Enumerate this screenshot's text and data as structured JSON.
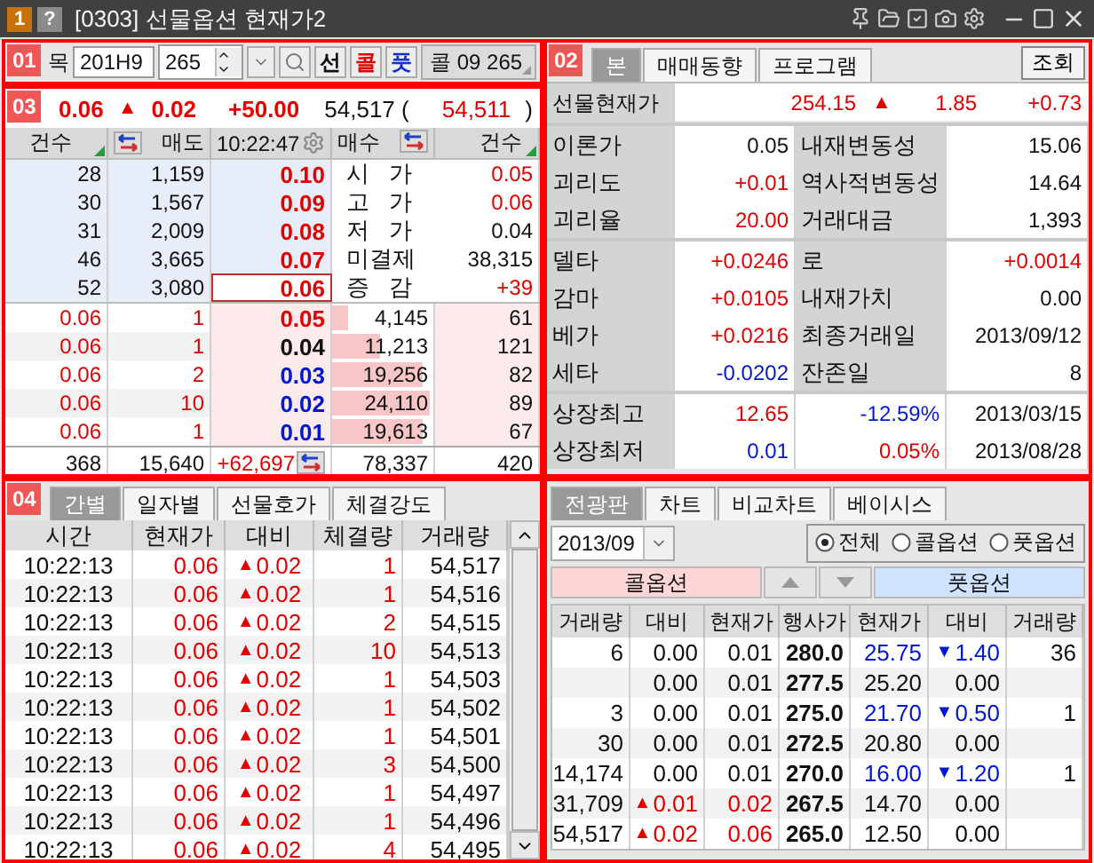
{
  "window": {
    "title": "[0303] 선물옵션 현재가2",
    "badges": [
      {
        "text": "1",
        "kind": "number"
      },
      {
        "text": "?",
        "kind": "help"
      }
    ]
  },
  "toolbar": {
    "marker": "01",
    "code_label": "목",
    "code": "201H9",
    "strike": "265",
    "type_buttons": [
      {
        "label": "선",
        "kind": "futures"
      },
      {
        "label": "콜",
        "kind": "call"
      },
      {
        "label": "풋",
        "kind": "put"
      }
    ],
    "selection": "콜 09 265"
  },
  "quote": {
    "marker": "03",
    "price": {
      "text": "0.06",
      "color": "#e00000"
    },
    "change": {
      "text": "0.02",
      "color": "#e00000",
      "arrow": "▲"
    },
    "rate": {
      "text": "+50.00",
      "color": "#e00000"
    },
    "volume": "54,517 (",
    "prev_volume": {
      "text": "54,511",
      "color": "#e00000"
    },
    "close": ")"
  },
  "orderbook": {
    "columns": [
      "건수",
      "매도",
      "10:22:47",
      "매수",
      "건수"
    ],
    "asks": [
      {
        "count": "28",
        "qty": "1,159",
        "price": {
          "text": "0.10",
          "color": "#e00000"
        },
        "current": false,
        "label": "시   가",
        "value": {
          "text": "0.05",
          "color": "#e00000"
        }
      },
      {
        "count": "30",
        "qty": "1,567",
        "price": {
          "text": "0.09",
          "color": "#e00000"
        },
        "current": false,
        "label": "고   가",
        "value": {
          "text": "0.06",
          "color": "#e00000"
        }
      },
      {
        "count": "31",
        "qty": "2,009",
        "price": {
          "text": "0.08",
          "color": "#e00000"
        },
        "current": false,
        "label": "저   가",
        "value": {
          "text": "0.04",
          "color": "#111111"
        }
      },
      {
        "count": "46",
        "qty": "3,665",
        "price": {
          "text": "0.07",
          "color": "#e00000"
        },
        "current": false,
        "label": "미결제",
        "value": {
          "text": "38,315",
          "color": "#111111"
        }
      },
      {
        "count": "52",
        "qty": "3,080",
        "price": {
          "text": "0.06",
          "color": "#e00000"
        },
        "current": true,
        "label": "증   감",
        "value": {
          "text": "+39",
          "color": "#e00000"
        }
      }
    ],
    "bids": [
      {
        "col_1": {
          "text": "0.06",
          "color": "#e00000"
        },
        "col_2": {
          "text": "1",
          "color": "#e00000"
        },
        "price": {
          "text": "0.05",
          "color": "#e00000"
        },
        "qty": "4,145",
        "level": 0.16,
        "count": "61"
      },
      {
        "col_1": {
          "text": "0.06",
          "color": "#e00000"
        },
        "col_2": {
          "text": "1",
          "color": "#e00000"
        },
        "price": {
          "text": "0.04",
          "color": "#111111"
        },
        "qty": "11,213",
        "level": 0.48,
        "count": "121"
      },
      {
        "col_1": {
          "text": "0.06",
          "color": "#e00000"
        },
        "col_2": {
          "text": "2",
          "color": "#e00000"
        },
        "price": {
          "text": "0.03",
          "color": "#0018d0"
        },
        "qty": "19,256",
        "level": 0.9,
        "count": "82"
      },
      {
        "col_1": {
          "text": "0.06",
          "color": "#e00000"
        },
        "col_2": {
          "text": "10",
          "color": "#e00000"
        },
        "price": {
          "text": "0.02",
          "color": "#0018d0"
        },
        "qty": "24,110",
        "level": 0.97,
        "count": "89"
      },
      {
        "col_1": {
          "text": "0.06",
          "color": "#e00000"
        },
        "col_2": {
          "text": "1",
          "color": "#e00000"
        },
        "price": {
          "text": "0.01",
          "color": "#0018d0"
        },
        "qty": "19,613",
        "level": 0.9,
        "count": "67"
      }
    ],
    "totals": {
      "ask_count": "368",
      "ask_qty": "15,640",
      "diff": {
        "text": "+62,697",
        "color": "#e00000"
      },
      "bid_qty": "78,337",
      "bid_count": "420"
    }
  },
  "info": {
    "marker": "02",
    "tabs": [
      {
        "label": "본",
        "selected": true
      },
      {
        "label": "매매동향",
        "selected": false
      },
      {
        "label": "프로그램",
        "selected": false
      }
    ],
    "query_button": "조회",
    "current": {
      "label": "선물현재가",
      "price": {
        "text": "254.15",
        "color": "#e00000"
      },
      "change": {
        "text": "1.85",
        "color": "#e00000",
        "arrow": "▲"
      },
      "rate": {
        "text": "+0.73",
        "color": "#e00000"
      }
    },
    "groups": [
      [
        {
          "label": "이론가",
          "value": {
            "text": "0.05",
            "color": "#111111"
          },
          "label_2": "내재변동성",
          "value_2": {
            "text": "15.06",
            "color": "#111111"
          }
        },
        {
          "label": "괴리도",
          "value": {
            "text": "+0.01",
            "color": "#e00000"
          },
          "label_2": "역사적변동성",
          "value_2": {
            "text": "14.64",
            "color": "#111111"
          }
        },
        {
          "label": "괴리율",
          "value": {
            "text": "20.00",
            "color": "#e00000"
          },
          "label_2": "거래대금",
          "value_2": {
            "text": "1,393",
            "color": "#111111"
          }
        }
      ],
      [
        {
          "label": "델타",
          "value": {
            "text": "+0.0246",
            "color": "#e00000"
          },
          "label_2": "로",
          "value_2": {
            "text": "+0.0014",
            "color": "#e00000"
          }
        },
        {
          "label": "감마",
          "value": {
            "text": "+0.0105",
            "color": "#e00000"
          },
          "label_2": "내재가치",
          "value_2": {
            "text": "0.00",
            "color": "#111111"
          }
        },
        {
          "label": "베가",
          "value": {
            "text": "+0.0216",
            "color": "#e00000"
          },
          "label_2": "최종거래일",
          "value_2": {
            "text": "2013/09/12",
            "color": "#111111"
          }
        },
        {
          "label": "세타",
          "value": {
            "text": "-0.0202",
            "color": "#0018d0"
          },
          "label_2": "잔존일",
          "value_2": {
            "text": "8",
            "color": "#111111"
          }
        }
      ]
    ],
    "listing": [
      {
        "label": "상장최고",
        "value": {
          "text": "12.65",
          "color": "#e00000"
        },
        "rate": {
          "text": "-12.59%",
          "color": "#0018d0"
        },
        "date": "2013/03/15"
      },
      {
        "label": "상장최저",
        "value": {
          "text": "0.01",
          "color": "#0018d0"
        },
        "rate": {
          "text": "0.05%",
          "color": "#e00000"
        },
        "date": "2013/08/28"
      }
    ]
  },
  "trades": {
    "marker": "04",
    "tabs": [
      {
        "label": "간별",
        "selected": true
      },
      {
        "label": "일자별",
        "selected": false
      },
      {
        "label": "선물호가",
        "selected": false
      },
      {
        "label": "체결강도",
        "selected": false
      }
    ],
    "columns": [
      "시간",
      "현재가",
      "대비",
      "체결량",
      "거래량"
    ],
    "rows": [
      {
        "time": "10:22:13",
        "price": "0.06",
        "arrow": "▲",
        "change": "0.02",
        "qty": "1",
        "volume": "54,517",
        "color": "#e00000"
      },
      {
        "time": "10:22:13",
        "price": "0.06",
        "arrow": "▲",
        "change": "0.02",
        "qty": "1",
        "volume": "54,516",
        "color": "#e00000"
      },
      {
        "time": "10:22:13",
        "price": "0.06",
        "arrow": "▲",
        "change": "0.02",
        "qty": "2",
        "volume": "54,515",
        "color": "#e00000"
      },
      {
        "time": "10:22:13",
        "price": "0.06",
        "arrow": "▲",
        "change": "0.02",
        "qty": "10",
        "volume": "54,513",
        "color": "#e00000"
      },
      {
        "time": "10:22:13",
        "price": "0.06",
        "arrow": "▲",
        "change": "0.02",
        "qty": "1",
        "volume": "54,503",
        "color": "#e00000"
      },
      {
        "time": "10:22:13",
        "price": "0.06",
        "arrow": "▲",
        "change": "0.02",
        "qty": "1",
        "volume": "54,502",
        "color": "#e00000"
      },
      {
        "time": "10:22:13",
        "price": "0.06",
        "arrow": "▲",
        "change": "0.02",
        "qty": "1",
        "volume": "54,501",
        "color": "#e00000"
      },
      {
        "time": "10:22:13",
        "price": "0.06",
        "arrow": "▲",
        "change": "0.02",
        "qty": "3",
        "volume": "54,500",
        "color": "#e00000"
      },
      {
        "time": "10:22:13",
        "price": "0.06",
        "arrow": "▲",
        "change": "0.02",
        "qty": "1",
        "volume": "54,497",
        "color": "#e00000"
      },
      {
        "time": "10:22:13",
        "price": "0.06",
        "arrow": "▲",
        "change": "0.02",
        "qty": "1",
        "volume": "54,496",
        "color": "#e00000"
      },
      {
        "time": "10:22:13",
        "price": "0.06",
        "arrow": "▲",
        "change": "0.02",
        "qty": "4",
        "volume": "54,495",
        "color": "#e00000"
      }
    ]
  },
  "board": {
    "tabs": [
      {
        "label": "전광판",
        "selected": true
      },
      {
        "label": "차트",
        "selected": false
      },
      {
        "label": "비교차트",
        "selected": false
      },
      {
        "label": "베이시스",
        "selected": false
      }
    ],
    "month": "2013/09",
    "filters": [
      {
        "label": "전체",
        "selected": true
      },
      {
        "label": "콜옵션",
        "selected": false
      },
      {
        "label": "풋옵션",
        "selected": false
      }
    ],
    "call_header": "콜옵션",
    "put_header": "풋옵션",
    "columns": [
      "거래량",
      "대비",
      "현재가",
      "행사가",
      "현재가",
      "대비",
      "거래량"
    ],
    "rows": [
      [
        {
          "text": "6",
          "color": "#111111"
        },
        {
          "text": "0.00",
          "color": "#111111"
        },
        {
          "text": "0.01",
          "color": "#111111"
        },
        {
          "text": "280.0",
          "color": "#111111"
        },
        {
          "text": "25.75",
          "color": "#0018d0"
        },
        {
          "text": "1.40",
          "color": "#0018d0",
          "arrow": "▼"
        },
        {
          "text": "36",
          "color": "#111111"
        }
      ],
      [
        null,
        {
          "text": "0.00",
          "color": "#111111"
        },
        {
          "text": "0.01",
          "color": "#111111"
        },
        {
          "text": "277.5",
          "color": "#111111"
        },
        {
          "text": "25.20",
          "color": "#111111"
        },
        {
          "text": "0.00",
          "color": "#111111"
        },
        null
      ],
      [
        {
          "text": "3",
          "color": "#111111"
        },
        {
          "text": "0.00",
          "color": "#111111"
        },
        {
          "text": "0.01",
          "color": "#111111"
        },
        {
          "text": "275.0",
          "color": "#111111"
        },
        {
          "text": "21.70",
          "color": "#0018d0"
        },
        {
          "text": "0.50",
          "color": "#0018d0",
          "arrow": "▼"
        },
        {
          "text": "1",
          "color": "#111111"
        }
      ],
      [
        {
          "text": "30",
          "color": "#111111"
        },
        {
          "text": "0.00",
          "color": "#111111"
        },
        {
          "text": "0.01",
          "color": "#111111"
        },
        {
          "text": "272.5",
          "color": "#111111"
        },
        {
          "text": "20.80",
          "color": "#111111"
        },
        {
          "text": "0.00",
          "color": "#111111"
        },
        null
      ],
      [
        {
          "text": "14,174",
          "color": "#111111"
        },
        {
          "text": "0.00",
          "color": "#111111"
        },
        {
          "text": "0.01",
          "color": "#111111"
        },
        {
          "text": "270.0",
          "color": "#111111"
        },
        {
          "text": "16.00",
          "color": "#0018d0"
        },
        {
          "text": "1.20",
          "color": "#0018d0",
          "arrow": "▼"
        },
        {
          "text": "1",
          "color": "#111111"
        }
      ],
      [
        {
          "text": "31,709",
          "color": "#111111"
        },
        {
          "text": "0.01",
          "color": "#e00000",
          "arrow": "▲"
        },
        {
          "text": "0.02",
          "color": "#e00000"
        },
        {
          "text": "267.5",
          "color": "#111111"
        },
        {
          "text": "14.70",
          "color": "#111111"
        },
        {
          "text": "0.00",
          "color": "#111111"
        },
        null
      ],
      [
        {
          "text": "54,517",
          "color": "#111111"
        },
        {
          "text": "0.02",
          "color": "#e00000",
          "arrow": "▲"
        },
        {
          "text": "0.06",
          "color": "#e00000"
        },
        {
          "text": "265.0",
          "color": "#111111"
        },
        {
          "text": "12.50",
          "color": "#111111"
        },
        {
          "text": "0.00",
          "color": "#111111"
        },
        null
      ]
    ]
  }
}
